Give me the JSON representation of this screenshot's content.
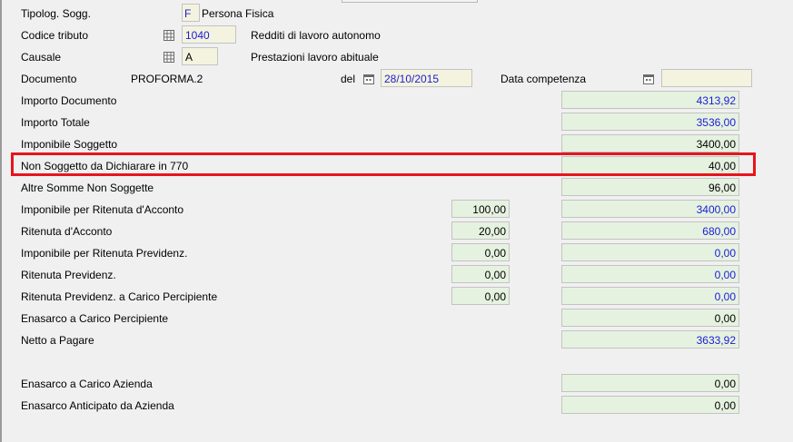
{
  "header": {
    "tipolog_label": "Tipolog. Sogg.",
    "tipolog_value": "F",
    "tipolog_desc": "Persona Fisica",
    "codice_label": "Codice tributo",
    "codice_value": "1040",
    "codice_desc": "Redditi di lavoro autonomo",
    "causale_label": "Causale",
    "causale_value": "A",
    "causale_desc": "Prestazioni lavoro abituale",
    "documento_label": "Documento",
    "documento_value": "PROFORMA.2",
    "del_label": "del",
    "del_value": "28/10/2015",
    "competenza_label": "Data competenza",
    "competenza_value": ""
  },
  "rows": [
    {
      "label": "Importo Documento",
      "mid": "",
      "value": "4313,92",
      "blue": true
    },
    {
      "label": "Importo Totale",
      "mid": "",
      "value": "3536,00",
      "blue": true
    },
    {
      "label": "Imponibile Soggetto",
      "mid": "",
      "value": "3400,00",
      "blue": false
    },
    {
      "label": "Non Soggetto da Dichiarare in 770",
      "mid": "",
      "value": "40,00",
      "blue": false
    },
    {
      "label": "Altre Somme Non Soggette",
      "mid": "",
      "value": "96,00",
      "blue": false
    },
    {
      "label": "Imponibile per Ritenuta d'Acconto",
      "mid": "100,00",
      "value": "3400,00",
      "blue": true
    },
    {
      "label": "Ritenuta d'Acconto",
      "mid": "20,00",
      "value": "680,00",
      "blue": true
    },
    {
      "label": "Imponibile per Ritenuta Previdenz.",
      "mid": "0,00",
      "value": "0,00",
      "blue": true
    },
    {
      "label": "Ritenuta Previdenz.",
      "mid": "0,00",
      "value": "0,00",
      "blue": true
    },
    {
      "label": "Ritenuta Previdenz. a Carico Percipiente",
      "mid": "0,00",
      "value": "0,00",
      "blue": true
    },
    {
      "label": "Enasarco a Carico Percipiente",
      "mid": "",
      "value": "0,00",
      "blue": false
    },
    {
      "label": "Netto a Pagare",
      "mid": "",
      "value": "3633,92",
      "blue": true
    },
    {
      "label": "Enasarco a Carico Azienda",
      "mid": "",
      "value": "0,00",
      "blue": false
    },
    {
      "label": "Enasarco Anticipato da Azienda",
      "mid": "",
      "value": "0,00",
      "blue": false
    }
  ],
  "icons": {
    "grid": "table-grid-icon",
    "calendar": "calendar-icon"
  },
  "colors": {
    "field_green": "#e6f2e0",
    "field_yellow": "#f3f3df",
    "value_blue": "#1b1bd6",
    "highlight": "#e8141c"
  }
}
